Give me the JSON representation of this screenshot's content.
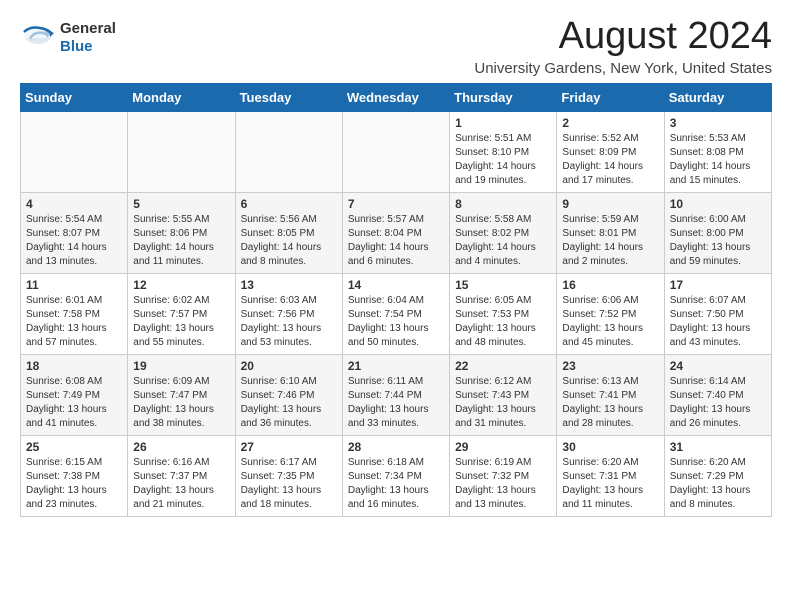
{
  "logo": {
    "general": "General",
    "blue": "Blue"
  },
  "title": "August 2024",
  "location": "University Gardens, New York, United States",
  "weekdays": [
    "Sunday",
    "Monday",
    "Tuesday",
    "Wednesday",
    "Thursday",
    "Friday",
    "Saturday"
  ],
  "weeks": [
    [
      {
        "day": "",
        "sunrise": "",
        "sunset": "",
        "daylight": ""
      },
      {
        "day": "",
        "sunrise": "",
        "sunset": "",
        "daylight": ""
      },
      {
        "day": "",
        "sunrise": "",
        "sunset": "",
        "daylight": ""
      },
      {
        "day": "",
        "sunrise": "",
        "sunset": "",
        "daylight": ""
      },
      {
        "day": "1",
        "sunrise": "Sunrise: 5:51 AM",
        "sunset": "Sunset: 8:10 PM",
        "daylight": "Daylight: 14 hours and 19 minutes."
      },
      {
        "day": "2",
        "sunrise": "Sunrise: 5:52 AM",
        "sunset": "Sunset: 8:09 PM",
        "daylight": "Daylight: 14 hours and 17 minutes."
      },
      {
        "day": "3",
        "sunrise": "Sunrise: 5:53 AM",
        "sunset": "Sunset: 8:08 PM",
        "daylight": "Daylight: 14 hours and 15 minutes."
      }
    ],
    [
      {
        "day": "4",
        "sunrise": "Sunrise: 5:54 AM",
        "sunset": "Sunset: 8:07 PM",
        "daylight": "Daylight: 14 hours and 13 minutes."
      },
      {
        "day": "5",
        "sunrise": "Sunrise: 5:55 AM",
        "sunset": "Sunset: 8:06 PM",
        "daylight": "Daylight: 14 hours and 11 minutes."
      },
      {
        "day": "6",
        "sunrise": "Sunrise: 5:56 AM",
        "sunset": "Sunset: 8:05 PM",
        "daylight": "Daylight: 14 hours and 8 minutes."
      },
      {
        "day": "7",
        "sunrise": "Sunrise: 5:57 AM",
        "sunset": "Sunset: 8:04 PM",
        "daylight": "Daylight: 14 hours and 6 minutes."
      },
      {
        "day": "8",
        "sunrise": "Sunrise: 5:58 AM",
        "sunset": "Sunset: 8:02 PM",
        "daylight": "Daylight: 14 hours and 4 minutes."
      },
      {
        "day": "9",
        "sunrise": "Sunrise: 5:59 AM",
        "sunset": "Sunset: 8:01 PM",
        "daylight": "Daylight: 14 hours and 2 minutes."
      },
      {
        "day": "10",
        "sunrise": "Sunrise: 6:00 AM",
        "sunset": "Sunset: 8:00 PM",
        "daylight": "Daylight: 13 hours and 59 minutes."
      }
    ],
    [
      {
        "day": "11",
        "sunrise": "Sunrise: 6:01 AM",
        "sunset": "Sunset: 7:58 PM",
        "daylight": "Daylight: 13 hours and 57 minutes."
      },
      {
        "day": "12",
        "sunrise": "Sunrise: 6:02 AM",
        "sunset": "Sunset: 7:57 PM",
        "daylight": "Daylight: 13 hours and 55 minutes."
      },
      {
        "day": "13",
        "sunrise": "Sunrise: 6:03 AM",
        "sunset": "Sunset: 7:56 PM",
        "daylight": "Daylight: 13 hours and 53 minutes."
      },
      {
        "day": "14",
        "sunrise": "Sunrise: 6:04 AM",
        "sunset": "Sunset: 7:54 PM",
        "daylight": "Daylight: 13 hours and 50 minutes."
      },
      {
        "day": "15",
        "sunrise": "Sunrise: 6:05 AM",
        "sunset": "Sunset: 7:53 PM",
        "daylight": "Daylight: 13 hours and 48 minutes."
      },
      {
        "day": "16",
        "sunrise": "Sunrise: 6:06 AM",
        "sunset": "Sunset: 7:52 PM",
        "daylight": "Daylight: 13 hours and 45 minutes."
      },
      {
        "day": "17",
        "sunrise": "Sunrise: 6:07 AM",
        "sunset": "Sunset: 7:50 PM",
        "daylight": "Daylight: 13 hours and 43 minutes."
      }
    ],
    [
      {
        "day": "18",
        "sunrise": "Sunrise: 6:08 AM",
        "sunset": "Sunset: 7:49 PM",
        "daylight": "Daylight: 13 hours and 41 minutes."
      },
      {
        "day": "19",
        "sunrise": "Sunrise: 6:09 AM",
        "sunset": "Sunset: 7:47 PM",
        "daylight": "Daylight: 13 hours and 38 minutes."
      },
      {
        "day": "20",
        "sunrise": "Sunrise: 6:10 AM",
        "sunset": "Sunset: 7:46 PM",
        "daylight": "Daylight: 13 hours and 36 minutes."
      },
      {
        "day": "21",
        "sunrise": "Sunrise: 6:11 AM",
        "sunset": "Sunset: 7:44 PM",
        "daylight": "Daylight: 13 hours and 33 minutes."
      },
      {
        "day": "22",
        "sunrise": "Sunrise: 6:12 AM",
        "sunset": "Sunset: 7:43 PM",
        "daylight": "Daylight: 13 hours and 31 minutes."
      },
      {
        "day": "23",
        "sunrise": "Sunrise: 6:13 AM",
        "sunset": "Sunset: 7:41 PM",
        "daylight": "Daylight: 13 hours and 28 minutes."
      },
      {
        "day": "24",
        "sunrise": "Sunrise: 6:14 AM",
        "sunset": "Sunset: 7:40 PM",
        "daylight": "Daylight: 13 hours and 26 minutes."
      }
    ],
    [
      {
        "day": "25",
        "sunrise": "Sunrise: 6:15 AM",
        "sunset": "Sunset: 7:38 PM",
        "daylight": "Daylight: 13 hours and 23 minutes."
      },
      {
        "day": "26",
        "sunrise": "Sunrise: 6:16 AM",
        "sunset": "Sunset: 7:37 PM",
        "daylight": "Daylight: 13 hours and 21 minutes."
      },
      {
        "day": "27",
        "sunrise": "Sunrise: 6:17 AM",
        "sunset": "Sunset: 7:35 PM",
        "daylight": "Daylight: 13 hours and 18 minutes."
      },
      {
        "day": "28",
        "sunrise": "Sunrise: 6:18 AM",
        "sunset": "Sunset: 7:34 PM",
        "daylight": "Daylight: 13 hours and 16 minutes."
      },
      {
        "day": "29",
        "sunrise": "Sunrise: 6:19 AM",
        "sunset": "Sunset: 7:32 PM",
        "daylight": "Daylight: 13 hours and 13 minutes."
      },
      {
        "day": "30",
        "sunrise": "Sunrise: 6:20 AM",
        "sunset": "Sunset: 7:31 PM",
        "daylight": "Daylight: 13 hours and 11 minutes."
      },
      {
        "day": "31",
        "sunrise": "Sunrise: 6:20 AM",
        "sunset": "Sunset: 7:29 PM",
        "daylight": "Daylight: 13 hours and 8 minutes."
      }
    ]
  ]
}
